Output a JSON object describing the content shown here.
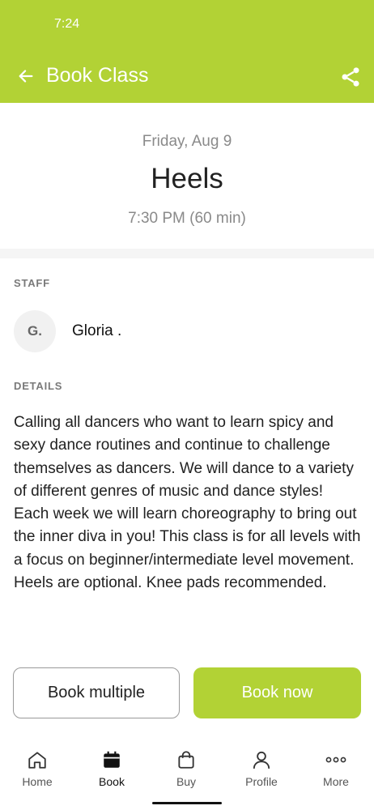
{
  "status": {
    "time": "7:24"
  },
  "header": {
    "title": "Book Class",
    "back_icon": "arrow-left-icon",
    "share_icon": "share-icon"
  },
  "class": {
    "date": "Friday, Aug 9",
    "name": "Heels",
    "time": "7:30 PM (60 min)"
  },
  "staff": {
    "label": "STAFF",
    "initials": "G.",
    "name": "Gloria ."
  },
  "details": {
    "label": "DETAILS",
    "text": "Calling all dancers who want to learn spicy and sexy dance routines and continue to challenge themselves as dancers. We will dance to a variety of different genres of music and dance styles! Each week we will learn choreography to bring out the inner diva in you! This class is for all levels with a focus on beginner/intermediate level movement. Heels are optional. Knee pads recommended."
  },
  "actions": {
    "book_multiple": "Book multiple",
    "book_now": "Book now"
  },
  "nav": {
    "active": "Book",
    "items": [
      {
        "label": "Home",
        "icon": "home-icon"
      },
      {
        "label": "Book",
        "icon": "calendar-icon"
      },
      {
        "label": "Buy",
        "icon": "shopping-bag-icon"
      },
      {
        "label": "Profile",
        "icon": "person-icon"
      },
      {
        "label": "More",
        "icon": "more-dots-icon"
      }
    ]
  },
  "colors": {
    "accent": "#b2d235",
    "muted_text": "#8a8a8a"
  }
}
